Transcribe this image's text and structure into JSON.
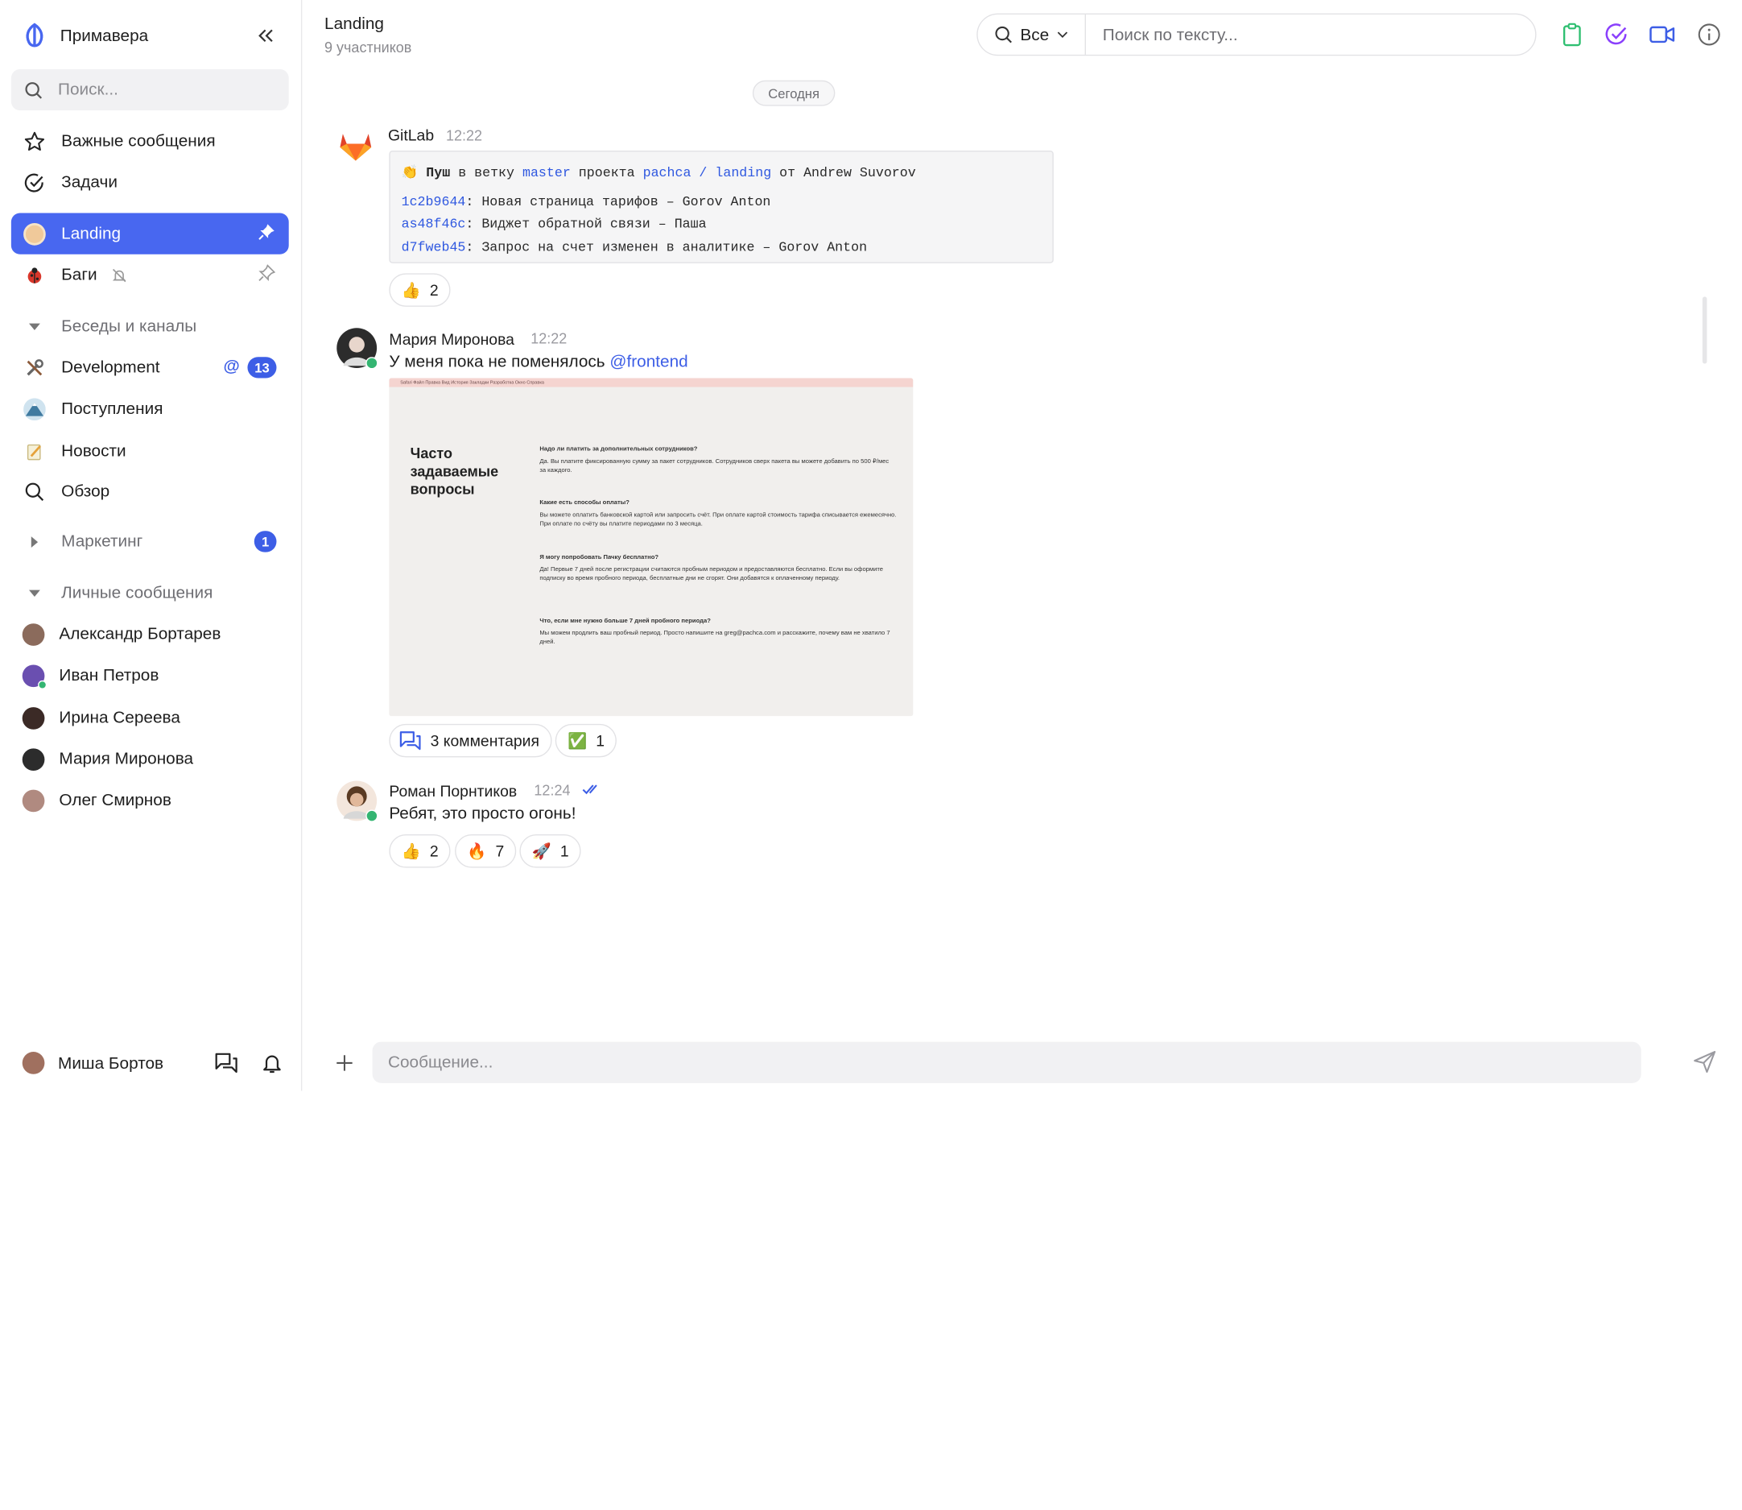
{
  "app": {
    "brand": "Примавера"
  },
  "sidebar": {
    "search_placeholder": "Поиск...",
    "top_items": [
      {
        "label": "Важные сообщения",
        "icon": "star-icon"
      },
      {
        "label": "Задачи",
        "icon": "check-circle-icon"
      }
    ],
    "pinned_chats": [
      {
        "label": "Landing",
        "icon": "landing-avatar",
        "active": true
      },
      {
        "label": "Баги",
        "icon": "ladybug-icon",
        "muted": true
      }
    ],
    "section_channels": "Беседы и каналы",
    "channels": [
      {
        "label": "Development",
        "icon": "tools-icon",
        "mention": "@",
        "badge": "13"
      },
      {
        "label": "Поступления",
        "icon": "mountain-avatar"
      },
      {
        "label": "Новости",
        "icon": "memo-icon"
      },
      {
        "label": "Обзор",
        "icon": "search-icon"
      }
    ],
    "section_marketing": "Маркетинг",
    "marketing_badge": "1",
    "section_dm": "Личные сообщения",
    "dms": [
      {
        "label": "Александр Бортарев",
        "color": "#8b6b5c",
        "online": false
      },
      {
        "label": "Иван Петров",
        "color": "#6a4fb0",
        "online": true
      },
      {
        "label": "Ирина Сереева",
        "color": "#3b2a26",
        "online": false
      },
      {
        "label": "Мария Миронова",
        "color": "#2c2c2c",
        "online": false
      },
      {
        "label": "Олег Смирнов",
        "color": "#b08a80",
        "online": false
      }
    ],
    "current_user": "Миша Бортов"
  },
  "header": {
    "title": "Landing",
    "subtitle": "9 участников",
    "filter_label": "Все",
    "search_placeholder": "Поиск по тексту..."
  },
  "chat": {
    "date_divider": "Сегодня",
    "messages": [
      {
        "author": "GitLab",
        "time": "12:22",
        "code": {
          "head_emoji": "👏",
          "head_bold": "Пуш",
          "head_t1": " в ветку ",
          "branch": "master",
          "head_t2": " проекта ",
          "project": "pachca / landing",
          "head_t3": " от Andrew Suvorov",
          "commits": [
            {
              "hash": "1c2b9644",
              "text": ": Новая страница тарифов – Gorov Anton"
            },
            {
              "hash": "as48f46c",
              "text": ": Виджет обратной связи – Паша"
            },
            {
              "hash": "d7fweb45",
              "text": ": Запрос на счет изменен в аналитике – Gorov Anton"
            }
          ]
        },
        "reactions": [
          {
            "emoji": "👍",
            "count": "2"
          }
        ]
      },
      {
        "author": "Мария Миронова",
        "time": "12:22",
        "text": "У меня пока не поменялось ",
        "mention": "@frontend",
        "screenshot": {
          "menu": "Safari   Файл   Правка   Вид   История   Закладки   Разработка   Окно   Справка",
          "title": "Часто задаваемые вопросы",
          "faq": [
            {
              "q": "Надо ли платить за дополнительных сотрудников?",
              "a": "Да. Вы платите фиксированную сумму за пакет сотрудников. Сотрудников сверх пакета вы можете добавить по 500 ₽/мес за каждого."
            },
            {
              "q": "Какие есть способы оплаты?",
              "a": "Вы можете оплатить банковской картой или запросить счёт. При оплате картой стоимость тарифа списывается ежемесячно. При оплате по счёту вы платите периодами по 3 месяца."
            },
            {
              "q": "Я могу попробовать Пачку бесплатно?",
              "a": "Да! Первые 7 дней после регистрации считаются пробным периодом и предоставляются бесплатно. Если вы оформите подписку во время пробного периода, бесплатные дни не сгорят. Они добавятся к оплаченному периоду."
            },
            {
              "q": "Что, если мне нужно больше 7 дней пробного периода?",
              "a": "Мы можем продлить ваш пробный период. Просто напишите на greg@pachca.com и расскажите, почему вам не хватило 7 дней."
            }
          ]
        },
        "comments": "3 комментария",
        "reactions": [
          {
            "emoji": "✅",
            "count": "1"
          }
        ]
      },
      {
        "author": "Роман Порнтиков",
        "time": "12:24",
        "text": "Ребят, это просто огонь!",
        "reactions": [
          {
            "emoji": "👍",
            "count": "2"
          },
          {
            "emoji": "🔥",
            "count": "7"
          },
          {
            "emoji": "🚀",
            "count": "1"
          }
        ]
      }
    ]
  },
  "composer": {
    "placeholder": "Сообщение..."
  },
  "colors": {
    "accent": "#4867f0",
    "badge": "#3d5ee6",
    "online": "#34b572",
    "task_check": "#8a3ffc",
    "clipboard": "#2fbf71"
  }
}
